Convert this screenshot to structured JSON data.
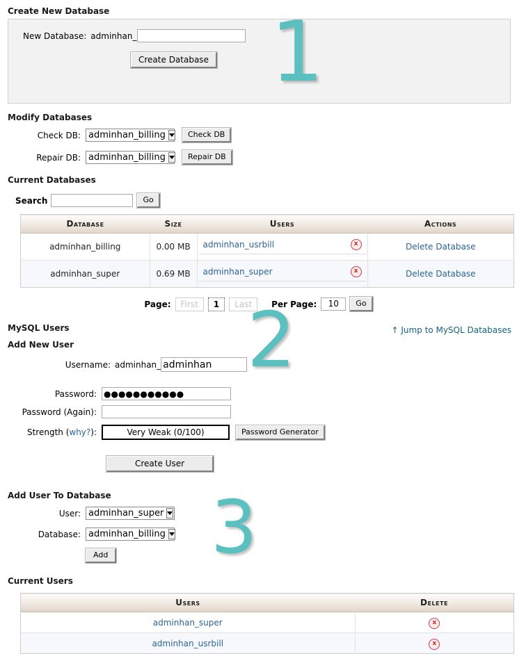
{
  "create_db": {
    "heading": "Create New Database",
    "field_label": "New Database:",
    "prefix": "adminhan_",
    "value": "",
    "button": "Create Database"
  },
  "modify_db": {
    "heading": "Modify Databases",
    "check_label": "Check DB:",
    "check_value": "adminhan_billing",
    "check_button": "Check DB",
    "repair_label": "Repair DB:",
    "repair_value": "adminhan_billing",
    "repair_button": "Repair DB"
  },
  "current_db": {
    "heading": "Current Databases",
    "search_label": "Search",
    "search_value": "",
    "search_button": "Go",
    "columns": [
      "Database",
      "Size",
      "Users",
      "Actions"
    ],
    "rows": [
      {
        "database": "adminhan_billing",
        "size": "0.00 MB",
        "user": "adminhan_usrbill",
        "delete_icon": "x",
        "action": "Delete Database"
      },
      {
        "database": "adminhan_super",
        "size": "0.69 MB",
        "user": "adminhan_super",
        "delete_icon": "x",
        "action": "Delete Database"
      }
    ],
    "pager": {
      "page_label": "Page:",
      "first": "First",
      "current": "1",
      "last": "Last",
      "per_page_label": "Per Page:",
      "per_page_value": "10",
      "go": "Go"
    }
  },
  "mysql_users": {
    "heading": "MySQL Users",
    "jump_link": "↑ Jump to MySQL Databases",
    "add_heading": "Add New User",
    "username_label": "Username:",
    "username_prefix": "adminhan_",
    "username_value": "adminhan",
    "password_label": "Password:",
    "password_value": "●●●●●●●●●●●",
    "password_again_label": "Password (Again):",
    "password_again_value": "",
    "strength_label": "Strength (",
    "strength_why": "why?",
    "strength_label_end": "):",
    "strength_value": "Very Weak (0/100)",
    "generator_button": "Password Generator",
    "create_button": "Create User"
  },
  "add_user_to_db": {
    "heading": "Add User To Database",
    "user_label": "User:",
    "user_value": "adminhan_super",
    "database_label": "Database:",
    "database_value": "adminhan_billing",
    "add_button": "Add"
  },
  "current_users": {
    "heading": "Current Users",
    "columns": [
      "Users",
      "Delete"
    ],
    "rows": [
      {
        "user": "adminhan_super",
        "delete_icon": "x"
      },
      {
        "user": "adminhan_usrbill",
        "delete_icon": "x"
      }
    ]
  },
  "steps": {
    "one": "1",
    "two": "2",
    "three": "3"
  },
  "colors": {
    "teal": "#5cbfc0",
    "link": "#2a6496",
    "header_tan": "#e0d5c9"
  }
}
